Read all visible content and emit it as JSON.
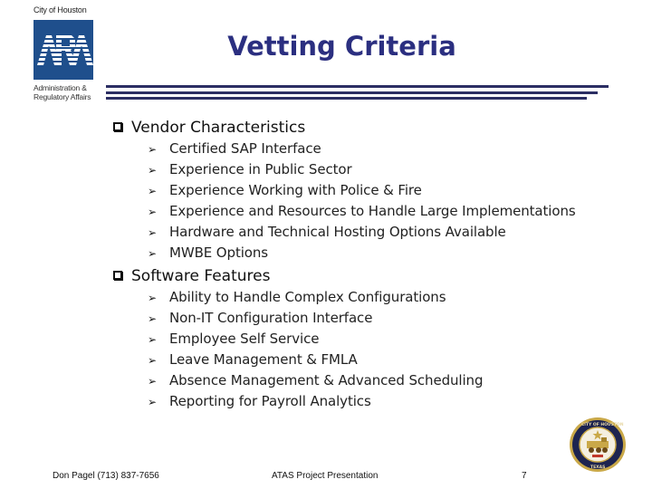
{
  "logo": {
    "city_label": "City of Houston",
    "acronym": "ARA",
    "org_line1": "Administration &",
    "org_line2": "Regulatory Affairs",
    "brand_color": "#1f4f8c"
  },
  "slide": {
    "title": "Vetting Criteria",
    "title_color": "#2b2f80",
    "rule_color": "#2b2e63"
  },
  "sections": [
    {
      "heading": "Vendor Characteristics",
      "items": [
        "Certified SAP Interface",
        "Experience in Public Sector",
        "Experience Working with Police & Fire",
        "Experience and Resources to Handle Large Implementations",
        "Hardware and Technical Hosting Options Available",
        "MWBE Options"
      ]
    },
    {
      "heading": "Software Features",
      "items": [
        "Ability to Handle Complex Configurations",
        "Non-IT Configuration Interface",
        "Employee Self Service",
        "Leave Management & FMLA",
        "Absence Management & Advanced Scheduling",
        "Reporting for Payroll Analytics"
      ]
    }
  ],
  "icons": {
    "section_bullet": "checkbox-square-icon",
    "item_bullet": "arrowhead-right-icon",
    "item_bullet_glyph": "➢",
    "seal": "city-of-houston-seal-icon"
  },
  "footer": {
    "contact": "Don Pagel (713) 837-7656",
    "presentation": "ATAS Project Presentation",
    "page_number": "7"
  }
}
